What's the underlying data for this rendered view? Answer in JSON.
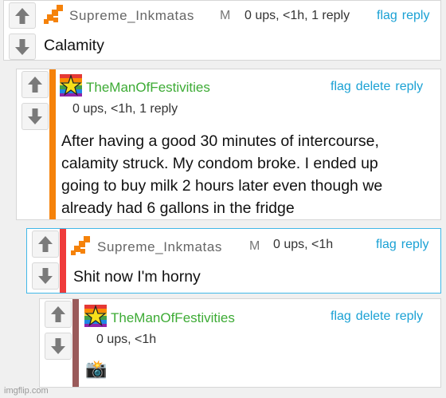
{
  "colors": {
    "link": "#1aa1d4",
    "username_green": "#3dab35",
    "bar_orange": "#f5820a",
    "bar_red": "#ef3b3b",
    "bar_brown": "#9a5a5a"
  },
  "icons": {
    "upvote": "arrow-up-icon",
    "downvote": "arrow-down-icon",
    "avatar_orange": "orange-pixel-avatar-icon",
    "avatar_rainbow_star": "rainbow-star-avatar-icon"
  },
  "comments": [
    {
      "username": "Supreme_Inkmatas",
      "mod_badge": "M",
      "meta": "0 ups, <1h, 1 reply",
      "actions": [
        "flag",
        "reply"
      ],
      "text": "Calamity"
    },
    {
      "username": "TheManOfFestivities",
      "meta": "0 ups, <1h, 1 reply",
      "actions": [
        "flag",
        "delete",
        "reply"
      ],
      "text_lines": [
        "After having a good 30 minutes of intercourse,",
        "calamity struck. My condom broke. I ended up",
        "going to buy milk 2 hours later even though we",
        "already had 6 gallons in the fridge"
      ]
    },
    {
      "username": "Supreme_Inkmatas",
      "mod_badge": "M",
      "meta": "0 ups, <1h",
      "actions": [
        "flag",
        "reply"
      ],
      "text": "Shit now I'm horny"
    },
    {
      "username": "TheManOfFestivities",
      "meta": "0 ups, <1h",
      "actions": [
        "flag",
        "delete",
        "reply"
      ],
      "emoji": "📸"
    }
  ],
  "watermark": "imgflip.com"
}
